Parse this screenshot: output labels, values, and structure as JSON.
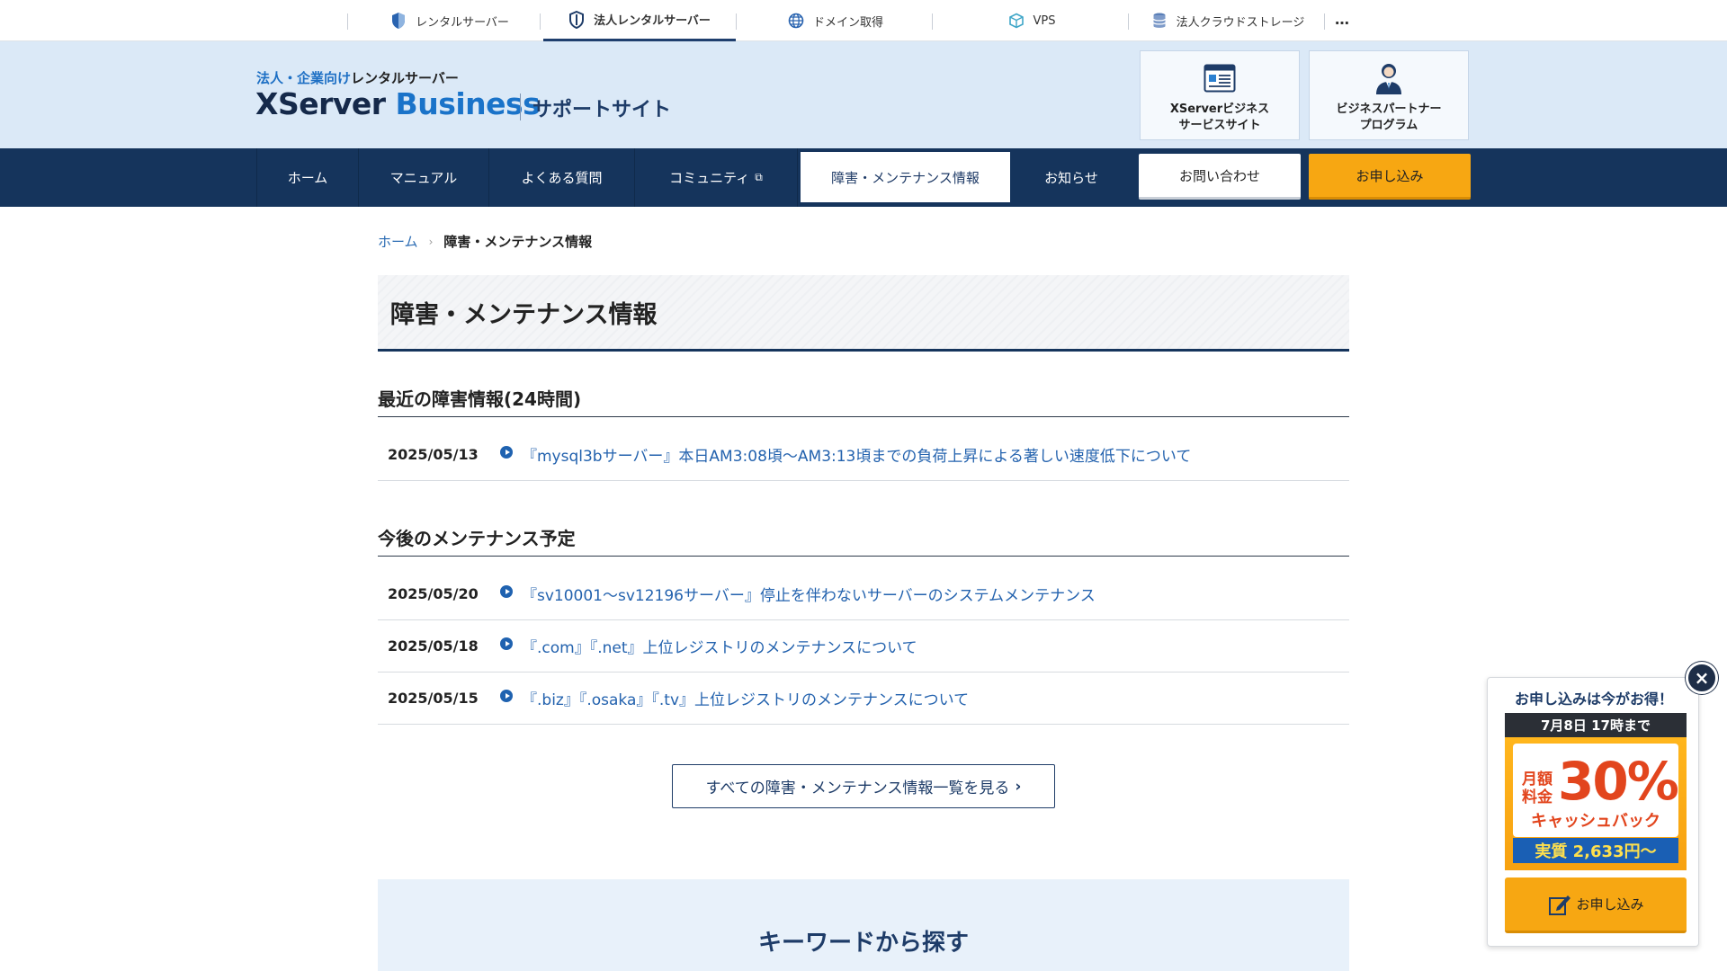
{
  "topbar": {
    "services": [
      {
        "label": "レンタルサーバー",
        "icon": "shield-half-icon"
      },
      {
        "label": "法人レンタルサーバー",
        "icon": "shield-icon",
        "active": true
      },
      {
        "label": "ドメイン取得",
        "icon": "globe-icon"
      },
      {
        "label": "VPS",
        "icon": "cube-icon"
      },
      {
        "label": "法人クラウドストレージ",
        "icon": "database-icon"
      }
    ],
    "more": "…"
  },
  "header": {
    "tagline_highlight": "法人・企業向け",
    "tagline_rest": "レンタルサーバー",
    "logo_x": "XServer",
    "logo_biz": "Business",
    "support_label": "サポートサイト",
    "cards": [
      {
        "line1": "XServerビジネス",
        "line2": "サービスサイト",
        "icon": "browser-window-icon"
      },
      {
        "line1": "ビジネスパートナー",
        "line2": "プログラム",
        "icon": "business-person-icon"
      }
    ]
  },
  "nav": {
    "items": [
      "ホーム",
      "マニュアル",
      "よくある質問",
      "コミュニティ",
      "障害・メンテナンス情報",
      "お知らせ"
    ],
    "active_index": 4,
    "external_icon": "⧉",
    "contact": "お問い合わせ",
    "apply": "お申し込み"
  },
  "breadcrumb": {
    "home": "ホーム",
    "separator": "›",
    "current": "障害・メンテナンス情報"
  },
  "page_title": "障害・メンテナンス情報",
  "incidents": {
    "heading": "最近の障害情報(24時間)",
    "items": [
      {
        "date": "2025/05/13",
        "title": "『mysql3bサーバー』本日AM3:08頃～AM3:13頃までの負荷上昇による著しい速度低下について"
      }
    ]
  },
  "maintenance": {
    "heading": "今後のメンテナンス予定",
    "items": [
      {
        "date": "2025/05/20",
        "title": "『sv10001～sv12196サーバー』停止を伴わないサーバーのシステムメンテナンス"
      },
      {
        "date": "2025/05/18",
        "title": "『.com』『.net』上位レジストリのメンテナンスについて"
      },
      {
        "date": "2025/05/15",
        "title": "『.biz』『.osaka』『.tv』上位レジストリのメンテナンスについて"
      }
    ]
  },
  "all_button": {
    "label": "すべての障害・メンテナンス情報一覧を見る",
    "chevron": "›"
  },
  "keyword": {
    "heading": "キーワードから探す"
  },
  "promo": {
    "title": "お申し込みは今がお得！",
    "deadline": "7月8日 17時まで",
    "label_line1": "月額",
    "label_line2": "料金",
    "percent": "30%",
    "cashback": "キャッシュバック",
    "real_price": "実質 2,633円～",
    "button": "お申し込み",
    "close": "×"
  },
  "colors": {
    "navy": "#15345c",
    "link": "#2362ae",
    "accent_orange": "#f7a712",
    "header_bg": "#dbe9f7"
  }
}
